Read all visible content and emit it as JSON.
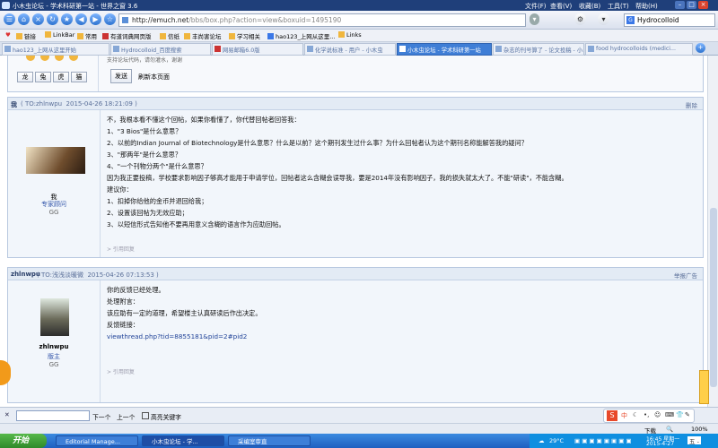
{
  "window": {
    "title": "小木虫论坛 - 学术科研第一站 - 世界之窗 3.6",
    "menu": [
      "文件(F)",
      "查看(V)",
      "收藏(B)",
      "工具(T)",
      "帮助(H)"
    ]
  },
  "addressbar": {
    "host": "http://emuch.net",
    "path": "/bbs/box.php?action=view&boxuid=1495190",
    "search_value": "Hydrocolloid"
  },
  "bookmarks": [
    "链接",
    "LinkBar",
    "常用",
    "有道词典网页版",
    "信纸",
    "丰尚害论坛",
    "学习相关",
    "hao123_上网从这里...",
    "Links"
  ],
  "tabs": [
    "hao123_上网从这里开始",
    "Hydrocolloid_百度搜索",
    "网易邮箱6.0版",
    "化学说标准 - 用户 - 小木虫",
    "小木虫论坛 - 学术科研第一站",
    "杂志的刊号算了 - 论文投稿 - 小...",
    "food hydrocolloids (medici..."
  ],
  "top_form": {
    "smilies": [
      "龙",
      "兔",
      "虎",
      "猫"
    ],
    "send_button": "发送",
    "refresh_link": "刷新本页面",
    "note": "支持论坛代码，请勿灌水，谢谢"
  },
  "post1": {
    "author": "我",
    "to": "( TO:zhlnwpu",
    "time": "2015-04-26 18:21:09 )",
    "action": "删除",
    "side_name": "我",
    "side_role": "专家顾问",
    "side_group": "GG",
    "lines": [
      "不，我根本看不懂这个回帖，如果你看懂了，你代替回帖者回答我：",
      "1、\"3 Bios\"是什么意思？",
      "2、以前的Indian Journal of Biotechnology是什么意思？什么是以前？这个期刊发生过什么事？为什么回帖者认为这个期刊名称能解答我的疑问？",
      "3、\"那两年\"是什么意思？",
      "4、\"一个刊物分两个\"是什么意思？",
      "因为我正要投稿，学校要求影响因子够高才能用于申请学位，回帖者这么含糊会误导我，要是2014年没有影响因子，我的损失就太大了。不能\"研读\"，不能含糊。",
      "建议你：",
      "1、扣掉你给他的金币并退回给我；",
      "2、设置该回帖为无效应助；",
      "3、以短信形式告知他不要再用意义含糊的语言作为应助回帖。"
    ],
    "footer": "> 引用回复"
  },
  "post2": {
    "author": "zhlnwpu",
    "to": "( TO:浅浅淡暖微",
    "time": "2015-04-26 07:13:53 )",
    "action": "举报广告",
    "side_name": "zhlnwpu",
    "side_role": "版主",
    "side_group": "GG",
    "lines": [
      "你的反馈已经处理。",
      "处理附言：",
      "该应助有一定的道理，希望楼主认真研读后作出决定。",
      "",
      "反馈链接：",
      "viewthread.php?tid=8855181&pid=2#pid2"
    ],
    "footer": "> 引用回复"
  },
  "findbar": {
    "input_value": "",
    "next_label": "下一个",
    "prev_label": "上一个",
    "highlight_label": "高亮关键字"
  },
  "statusbar": {
    "zoom": "100%",
    "download": "下载"
  },
  "taskbar": {
    "start": "开始",
    "tasks": [
      "Editorial Manage...",
      "小木虫论坛 - 学...",
      "采编室审直"
    ],
    "weather": "29°C",
    "time": "16:45 星期一",
    "date": "2015-4-27",
    "input_method": "五 -"
  }
}
